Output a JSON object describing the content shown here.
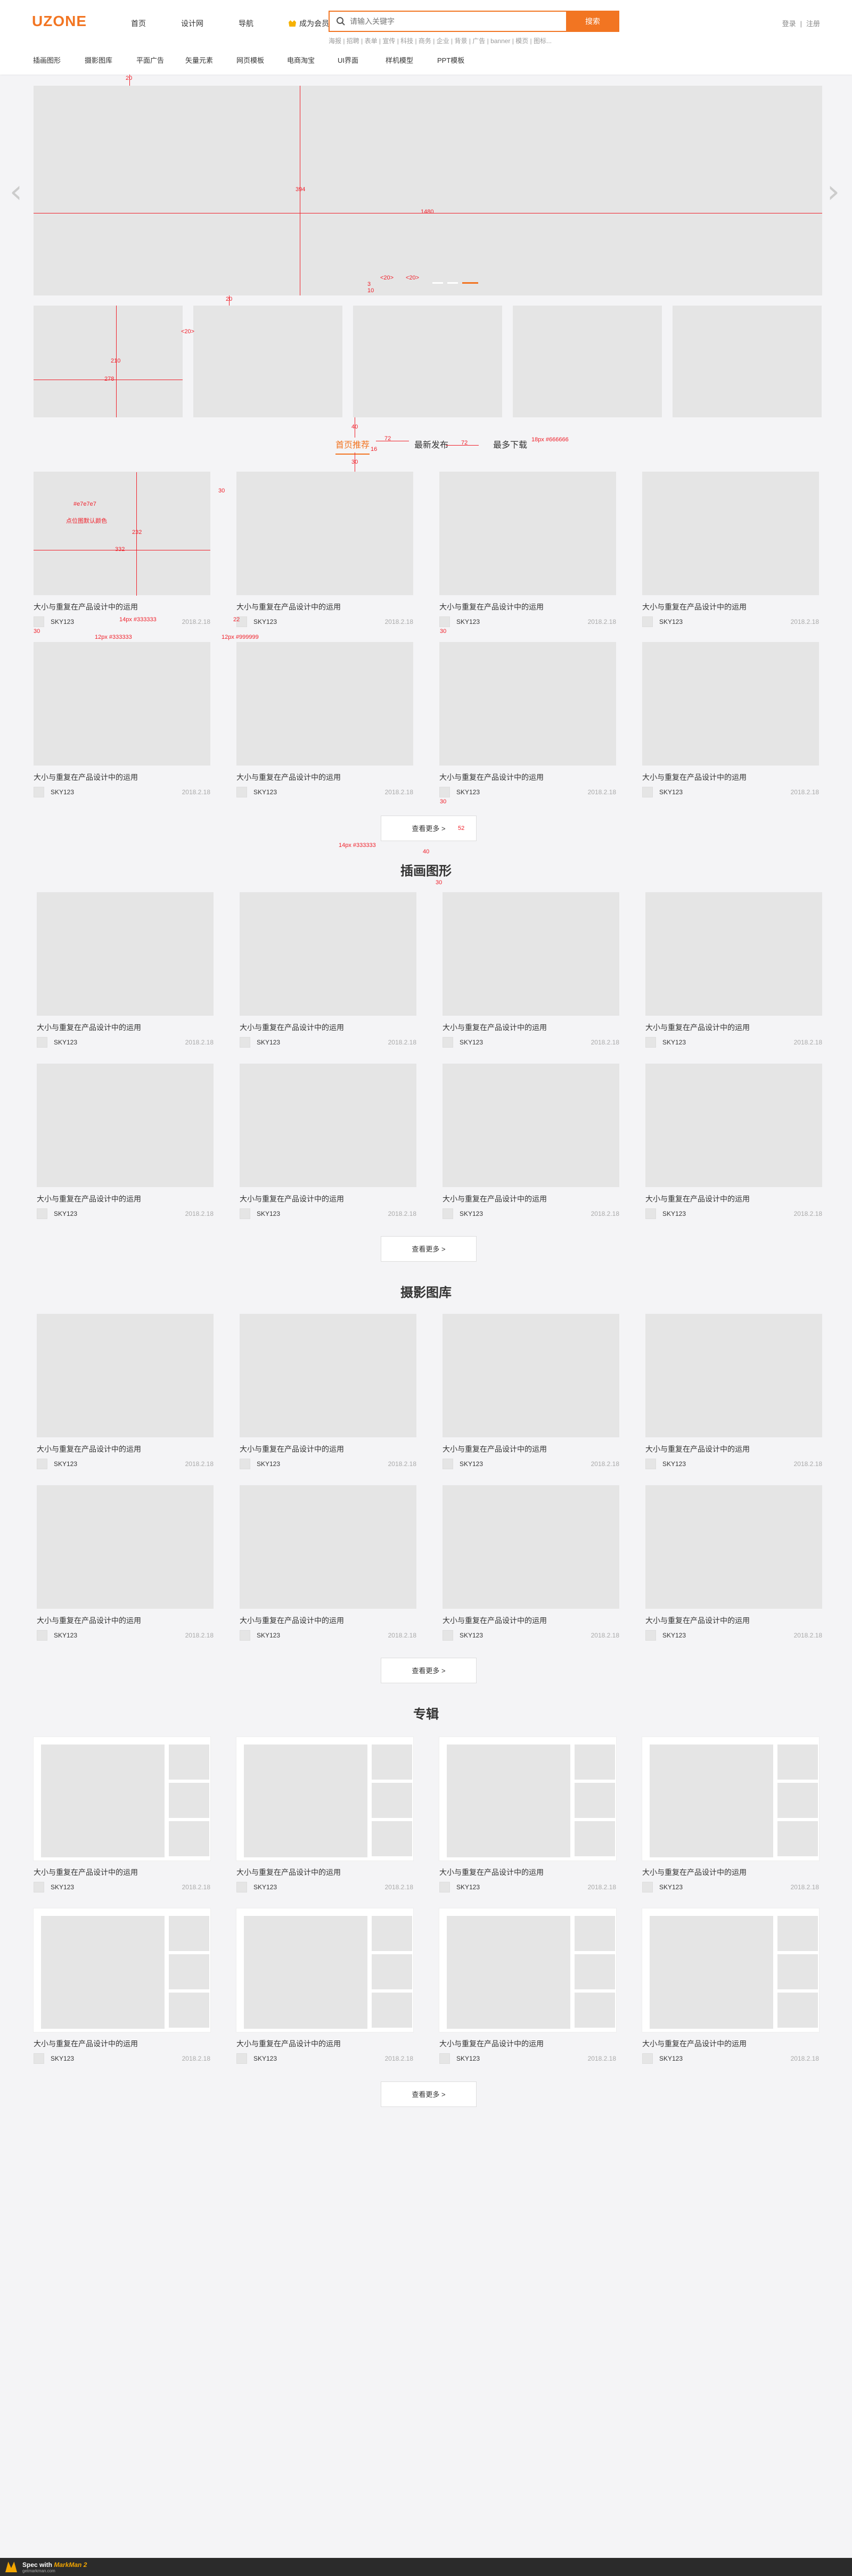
{
  "header": {
    "logo": "UZONE",
    "nav": [
      "首页",
      "设计网",
      "导航"
    ],
    "vip_label": "成为会员",
    "search_placeholder": "请输入关键字",
    "search_button": "搜索",
    "hot_words": "海报 | 招聘 | 表单 | 宣传 | 科技 | 商务 | 企业 | 背景 | 广告 | banner | 模页 | 图标...",
    "login": "登录",
    "separator": "|",
    "register": "注册"
  },
  "subnav": [
    "插画图形",
    "摄影图库",
    "平面广告",
    "矢量元素",
    "网页模板",
    "电商淘宝",
    "UI界面",
    "样机模型",
    "PPT模板"
  ],
  "tabs": [
    "首页推荐",
    "最新发布",
    "最多下载"
  ],
  "section_titles": {
    "illustration": "插画图形",
    "photo": "摄影图库",
    "album": "专辑"
  },
  "card": {
    "title": "大小与重复在产品设计中的运用",
    "author": "SKY123",
    "date": "2018.2.18"
  },
  "more_button": "查看更多 >",
  "annotations": {
    "a20": "20",
    "a394": "394",
    "a1480": "1480",
    "a20b": "20",
    "a20c": "<20>",
    "a20d": "<20>",
    "a3": "3",
    "a10": "10",
    "a210": "210",
    "a278": "278",
    "a20e": "<20>",
    "a40": "40",
    "a72": "72",
    "a72b": "72",
    "a16": "16",
    "a30": "30",
    "tab_note": "18px #666666",
    "color_e7": "#e7e7e7",
    "fill_note": "点位图默认颜色",
    "a232": "232",
    "a332": "332",
    "a30b": "30",
    "a14": "14px #333333",
    "a12": "12px #333333",
    "a12b": "12px #999999",
    "a22": "22",
    "a30c": "30",
    "a30d": "30",
    "a30e": "30",
    "a52": "52",
    "a40b": "40",
    "a30f": "30",
    "btn_note": "14px #333333"
  },
  "footer": {
    "label": "Spec with",
    "brand": "MarkMan 2",
    "site": "getmarkman.com"
  },
  "colors": {
    "accent": "#f27522",
    "placeholder": "#e5e5e5",
    "annotation": "#f0202a"
  }
}
